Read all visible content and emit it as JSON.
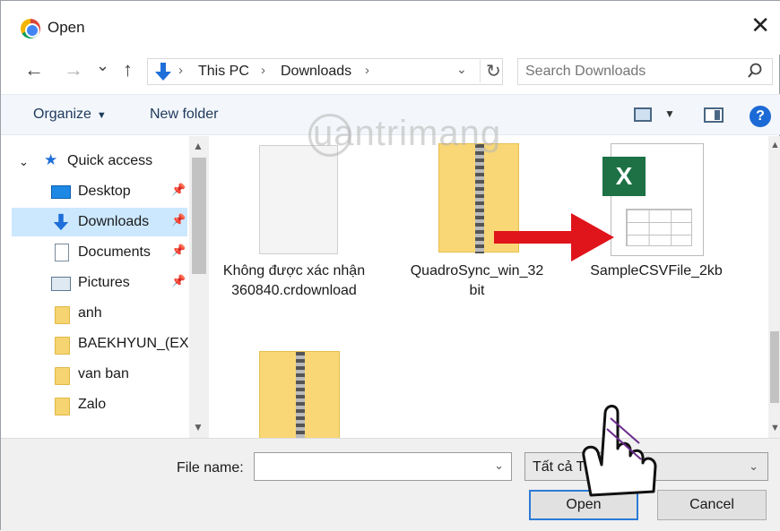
{
  "window": {
    "title": "Open",
    "close_glyph": "✕"
  },
  "nav": {
    "back": "←",
    "forward": "→",
    "recent": "⌄",
    "up": "↑"
  },
  "address": {
    "breadcrumbs": [
      "This PC",
      "Downloads"
    ],
    "separator": "›",
    "dropdown": "⌄",
    "refresh": "↻"
  },
  "search": {
    "placeholder": "Search Downloads"
  },
  "toolbar": {
    "organize_label": "Organize",
    "new_folder_label": "New folder",
    "help_label": "?"
  },
  "sidebar": {
    "items": [
      {
        "label": "Quick access",
        "icon": "star-icon"
      },
      {
        "label": "Desktop",
        "icon": "desktop-icon",
        "pinned": true
      },
      {
        "label": "Downloads",
        "icon": "downloads-icon",
        "pinned": true,
        "selected": true
      },
      {
        "label": "Documents",
        "icon": "documents-icon",
        "pinned": true
      },
      {
        "label": "Pictures",
        "icon": "pictures-icon",
        "pinned": true
      },
      {
        "label": "anh",
        "icon": "folder-icon"
      },
      {
        "label": "BAEKHYUN_(EX(",
        "icon": "folder-icon"
      },
      {
        "label": "van ban",
        "icon": "folder-icon"
      },
      {
        "label": "Zalo",
        "icon": "folder-icon"
      }
    ]
  },
  "files": [
    {
      "name": "Không được xác nhận 360840.crdownload",
      "icon": "document-icon"
    },
    {
      "name": "QuadroSync_win_32bit",
      "icon": "zip-folder-icon"
    },
    {
      "name": "SampleCSVFile_2kb",
      "icon": "excel-csv-icon"
    },
    {
      "name": "",
      "icon": "zip-folder-icon"
    }
  ],
  "csv_badge": "X",
  "watermark": "uantrimang",
  "bottom": {
    "file_name_label": "File name:",
    "file_name_value": "",
    "file_type_value": "Tất cả Tệp tin",
    "open_label": "Open",
    "cancel_label": "Cancel"
  },
  "colors": {
    "accent": "#2b7bd6",
    "selected_bg": "#cce8ff",
    "arrow_red": "#e0141b"
  }
}
